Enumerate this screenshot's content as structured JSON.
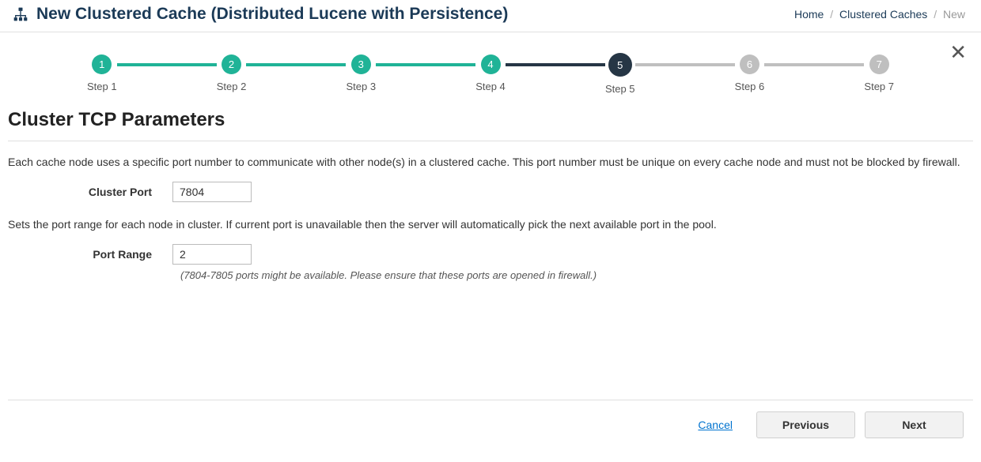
{
  "header": {
    "title": "New Clustered Cache (Distributed Lucene with Persistence)"
  },
  "breadcrumb": {
    "home": "Home",
    "caches": "Clustered Caches",
    "current": "New"
  },
  "stepper": {
    "steps": [
      {
        "num": "1",
        "label": "Step 1",
        "state": "done"
      },
      {
        "num": "2",
        "label": "Step 2",
        "state": "done"
      },
      {
        "num": "3",
        "label": "Step 3",
        "state": "done"
      },
      {
        "num": "4",
        "label": "Step 4",
        "state": "done"
      },
      {
        "num": "5",
        "label": "Step 5",
        "state": "active"
      },
      {
        "num": "6",
        "label": "Step 6",
        "state": "pending"
      },
      {
        "num": "7",
        "label": "Step 7",
        "state": "pending"
      }
    ]
  },
  "section": {
    "title": "Cluster TCP Parameters",
    "cluster_port_desc": "Each cache node uses a specific port number to communicate with other node(s) in a clustered cache. This port number must be unique on every cache node and must not be blocked by firewall.",
    "cluster_port_label": "Cluster Port",
    "cluster_port_value": "7804",
    "port_range_desc": "Sets the port range for each node in cluster. If current port is unavailable then the server will automatically pick the next available port in the pool.",
    "port_range_label": "Port Range",
    "port_range_value": "2",
    "port_range_hint": "(7804-7805 ports might be available. Please ensure that these ports are opened in firewall.)"
  },
  "footer": {
    "cancel": "Cancel",
    "previous": "Previous",
    "next": "Next"
  }
}
